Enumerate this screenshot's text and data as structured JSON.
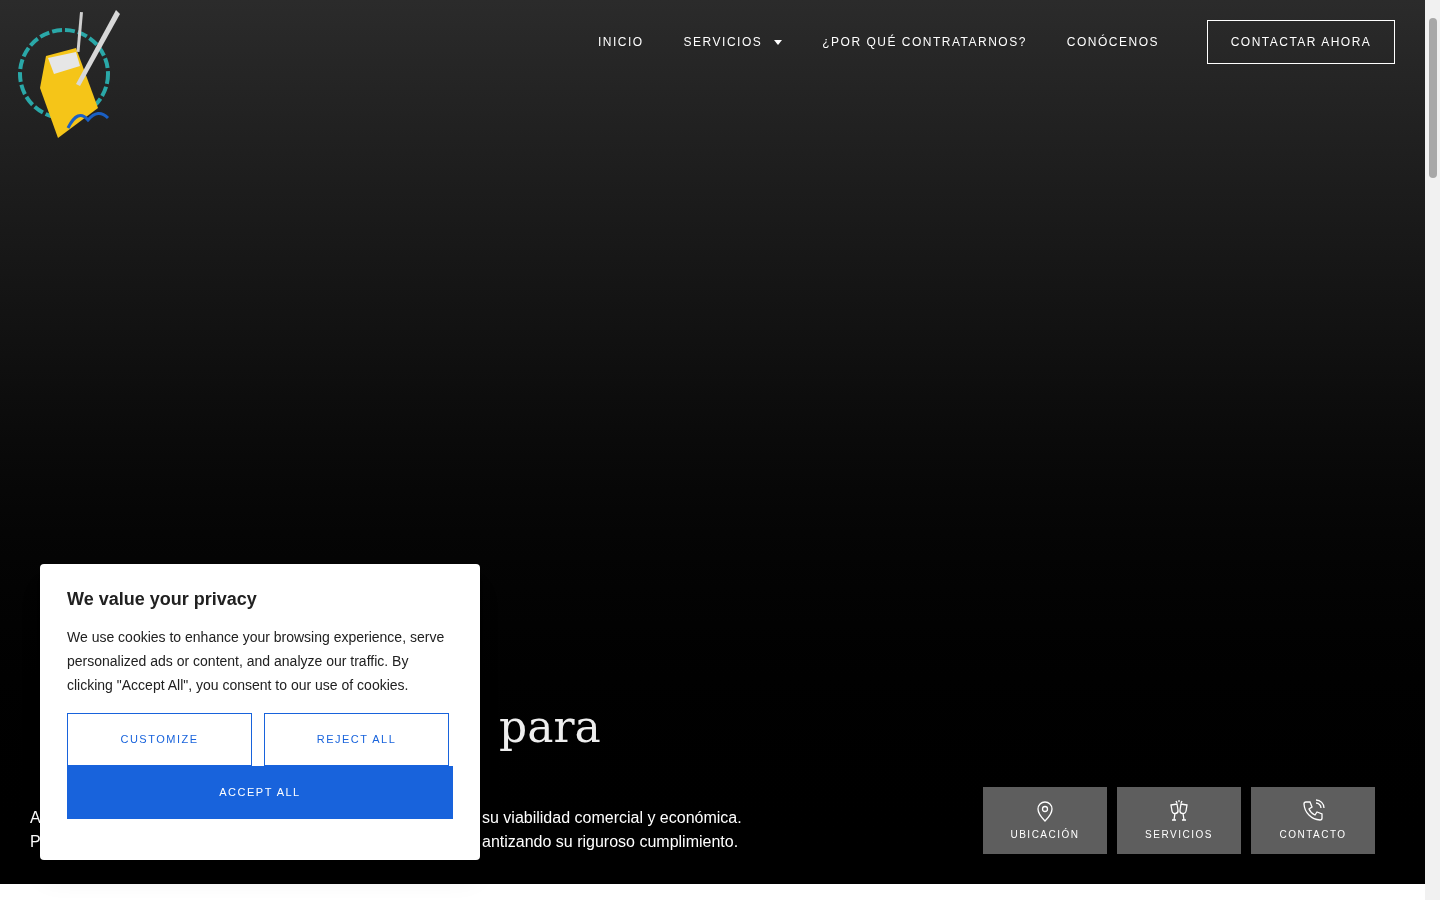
{
  "nav": {
    "items": [
      {
        "label": "INICIO",
        "dropdown": false
      },
      {
        "label": "SERVICIOS",
        "dropdown": true
      },
      {
        "label": "¿POR QUÉ CONTRATARNOS?",
        "dropdown": false
      },
      {
        "label": "CONÓCENOS",
        "dropdown": false
      }
    ],
    "cta": "CONTACTAR AHORA"
  },
  "hero": {
    "heading_visible": "para",
    "paragraph_fragments": [
      {
        "left": "A",
        "right": "su viabilidad comercial y económica."
      },
      {
        "left": "P",
        "right": "antizando su riguroso cumplimiento."
      }
    ]
  },
  "quick_links": [
    {
      "kind": "location",
      "label": "UBICACIÓN"
    },
    {
      "kind": "toast",
      "label": "SERVICIOS"
    },
    {
      "kind": "phone",
      "label": "CONTACTO"
    }
  ],
  "cookie_dialog": {
    "title": "We value your privacy",
    "body": "We use cookies to enhance your browsing experience, serve personalized ads or content, and analyze our traffic. By clicking \"Accept All\", you consent to our use of cookies.",
    "buttons": [
      {
        "label": "CUSTOMIZE",
        "kind": "outline"
      },
      {
        "label": "REJECT ALL",
        "kind": "outline"
      },
      {
        "label": "ACCEPT ALL",
        "kind": "primary"
      }
    ]
  }
}
